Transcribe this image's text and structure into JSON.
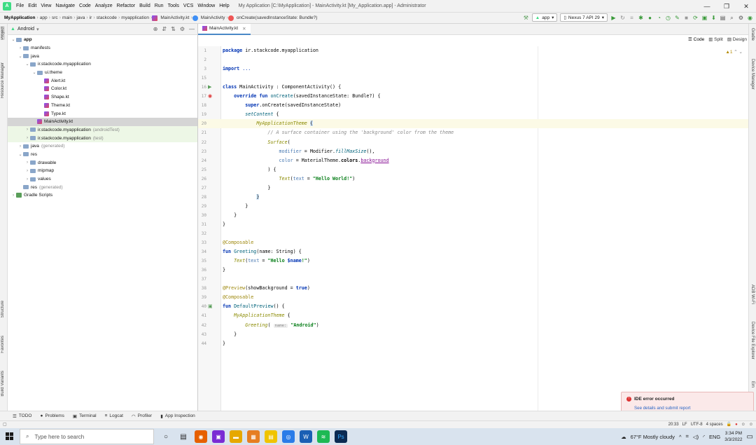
{
  "menubar": {
    "items": [
      "File",
      "Edit",
      "View",
      "Navigate",
      "Code",
      "Analyze",
      "Refactor",
      "Build",
      "Run",
      "Tools",
      "VCS",
      "Window",
      "Help"
    ],
    "window_title": "My Application [C:\\MyApplication] - MainActivity.kt [My_Application.app] - Administrator"
  },
  "navbar": {
    "crumbs": [
      "MyApplication",
      "app",
      "src",
      "main",
      "java",
      "ir",
      "stackcode",
      "myapplication",
      "MainActivity.kt",
      "MainActivity",
      "onCreate(savedInstanceState: Bundle?)"
    ],
    "module_select": "app",
    "device_select": "Nexus 7 API 29"
  },
  "leftstrip": {
    "labels": [
      "Project",
      "Resource Manager",
      "Structure",
      "Favorites",
      "Build Variants"
    ]
  },
  "rightstrip": {
    "labels": [
      "Gradle",
      "Device Manager",
      "ADB Wi-Fi",
      "Device File Explorer",
      "Em"
    ]
  },
  "project": {
    "view_select": "Android",
    "tree": [
      {
        "label": "app",
        "indent": 0,
        "arrow": "v",
        "icon": "folder",
        "bold": true
      },
      {
        "label": "manifests",
        "indent": 1,
        "arrow": ">",
        "icon": "folder"
      },
      {
        "label": "java",
        "indent": 1,
        "arrow": "v",
        "icon": "folder"
      },
      {
        "label": "ir.stackcode.myapplication",
        "indent": 2,
        "arrow": "v",
        "icon": "pkg"
      },
      {
        "label": "ui.theme",
        "indent": 3,
        "arrow": "v",
        "icon": "pkg"
      },
      {
        "label": "Alert.kt",
        "indent": 4,
        "arrow": "",
        "icon": "kt"
      },
      {
        "label": "Color.kt",
        "indent": 4,
        "arrow": "",
        "icon": "kt"
      },
      {
        "label": "Shape.kt",
        "indent": 4,
        "arrow": "",
        "icon": "kt"
      },
      {
        "label": "Theme.kt",
        "indent": 4,
        "arrow": "",
        "icon": "kt"
      },
      {
        "label": "Type.kt",
        "indent": 4,
        "arrow": "",
        "icon": "kt"
      },
      {
        "label": "MainActivity.kt",
        "indent": 3,
        "arrow": "",
        "icon": "kt",
        "selected": true
      },
      {
        "label": "ir.stackcode.myapplication",
        "suffix": "(androidTest)",
        "indent": 2,
        "arrow": ">",
        "icon": "pkg",
        "test": true
      },
      {
        "label": "ir.stackcode.myapplication",
        "suffix": "(test)",
        "indent": 2,
        "arrow": ">",
        "icon": "pkg",
        "test": true
      },
      {
        "label": "java",
        "suffix": "(generated)",
        "indent": 1,
        "arrow": ">",
        "icon": "folder"
      },
      {
        "label": "res",
        "indent": 1,
        "arrow": "v",
        "icon": "folder"
      },
      {
        "label": "drawable",
        "indent": 2,
        "arrow": ">",
        "icon": "folder"
      },
      {
        "label": "mipmap",
        "indent": 2,
        "arrow": ">",
        "icon": "folder"
      },
      {
        "label": "values",
        "indent": 2,
        "arrow": ">",
        "icon": "folder"
      },
      {
        "label": "res",
        "suffix": "(generated)",
        "indent": 1,
        "arrow": "",
        "icon": "folder"
      },
      {
        "label": "Gradle Scripts",
        "indent": 0,
        "arrow": ">",
        "icon": "gradle"
      }
    ]
  },
  "editor": {
    "tab_label": "MainActivity.kt",
    "modes": [
      "Code",
      "Split",
      "Design"
    ],
    "warning_count": "1",
    "highlight_line": 20,
    "lines": [
      {
        "n": "1",
        "html": "<span class=\"kw\">package</span> ir.stackcode.myapplication"
      },
      {
        "n": "2",
        "html": ""
      },
      {
        "n": "3",
        "html": "<span class=\"kw\">import</span> <span style=\"color:#0033b3\">...</span>"
      },
      {
        "n": "15",
        "html": ""
      },
      {
        "n": "16",
        "html": "<span class=\"kw\">class</span> MainActivity : ComponentActivity() {"
      },
      {
        "n": "17",
        "html": "    <span class=\"kw\">override fun</span> <span class=\"fn\">onCreate</span>(savedInstanceState: Bundle?) {"
      },
      {
        "n": "18",
        "html": "        <span class=\"kw\">super</span>.onCreate(savedInstanceState)"
      },
      {
        "n": "19",
        "html": "        <span class=\"it\">setContent</span> {"
      },
      {
        "n": "20",
        "html": "            <span class=\"cp\">MyApplicationTheme</span> <span class=\"brace\">{</span>"
      },
      {
        "n": "21",
        "html": "                <span class=\"cm\">// A surface container using the 'background' color from the theme</span>"
      },
      {
        "n": "22",
        "html": "                <span class=\"cp\">Surface</span>("
      },
      {
        "n": "23",
        "html": "                    <span style=\"color:#4a7ab3\">modifier</span> = Modifier.<span class=\"it\">fillMaxSize</span>(),"
      },
      {
        "n": "24",
        "html": "                    <span style=\"color:#4a7ab3\">color</span> = MaterialTheme.<span class=\"pr\" style=\"font-weight:bold;color:#000\">colors</span>.<span class=\"pr\" style=\"text-decoration:underline\">background</span>"
      },
      {
        "n": "25",
        "html": "                ) {"
      },
      {
        "n": "26",
        "html": "                    <span class=\"cp\">Text</span>(<span style=\"color:#4a7ab3\">text</span> = <span class=\"st\">\"Hello World!\"</span>)"
      },
      {
        "n": "27",
        "html": "                }"
      },
      {
        "n": "28",
        "html": "            <span class=\"brace\">}</span>"
      },
      {
        "n": "29",
        "html": "        }"
      },
      {
        "n": "30",
        "html": "    }"
      },
      {
        "n": "31",
        "html": "}"
      },
      {
        "n": "32",
        "html": ""
      },
      {
        "n": "33",
        "html": "<span class=\"an\">@Composable</span>"
      },
      {
        "n": "34",
        "html": "<span class=\"kw\">fun</span> <span class=\"fn\">Greeting</span>(name: String) {"
      },
      {
        "n": "35",
        "html": "    <span class=\"cp\">Text</span>(<span style=\"color:#4a7ab3\">text</span> = <span class=\"st\">\"Hello </span><span style=\"color:#0033b3;font-weight:bold\">$name</span><span class=\"st\">!\"</span>)"
      },
      {
        "n": "36",
        "html": "}"
      },
      {
        "n": "37",
        "html": ""
      },
      {
        "n": "38",
        "html": "<span class=\"an\">@Preview</span>(showBackground = <span class=\"kw\">true</span>)"
      },
      {
        "n": "39",
        "html": "<span class=\"an\">@Composable</span>"
      },
      {
        "n": "40",
        "html": "<span class=\"kw\">fun</span> <span class=\"fn\">DefaultPreview</span>() {"
      },
      {
        "n": "41",
        "html": "    <span class=\"cp\">MyApplicationTheme</span> {"
      },
      {
        "n": "42",
        "html": "        <span class=\"cp\">Greeting</span>( <span class=\"hint\">name:</span> <span class=\"st\">\"Android\"</span>)"
      },
      {
        "n": "43",
        "html": "    }"
      },
      {
        "n": "44",
        "html": "}"
      }
    ]
  },
  "notification": {
    "title": "IDE error occurred",
    "link": "See details and submit report"
  },
  "bottom_tools": [
    "TODO",
    "Problems",
    "Terminal",
    "Logcat",
    "Profiler",
    "App Inspection"
  ],
  "status": {
    "position": "20:33",
    "line_sep": "LF",
    "encoding": "UTF-8",
    "indent": "4 spaces"
  },
  "taskbar": {
    "search_placeholder": "Type here to search",
    "weather": "67°F  Mostly cloudy",
    "lang": "ENG",
    "time": "3:34 PM",
    "date": "3/3/2022"
  },
  "colors": {
    "accent": "#4a88c7",
    "selection": "#d5d5d5",
    "test_bg": "#edf7e6",
    "android": "#3ddc84"
  }
}
